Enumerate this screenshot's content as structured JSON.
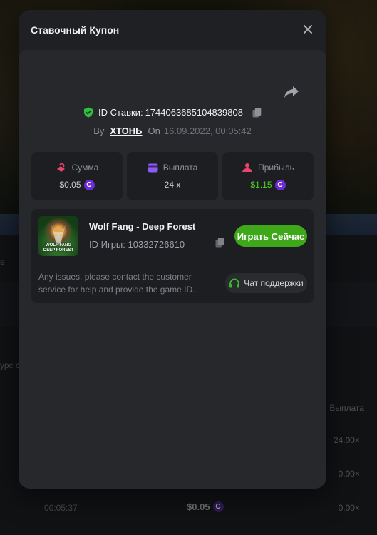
{
  "modal": {
    "title": "Ставочный Купон",
    "bet_id_label": "ID Ставки:",
    "bet_id": "1744063685104839808",
    "by_label": "By",
    "username": "ХТОНЬ",
    "on_label": "On",
    "date": "16.09.2022, 00:05:42"
  },
  "stats": {
    "amount_label": "Сумма",
    "amount_value": "$0.05",
    "payout_label": "Выплата",
    "payout_value": "24 x",
    "profit_label": "Прибыль",
    "profit_value": "$1.15"
  },
  "game": {
    "name": "Wolf Fang - Deep Forest",
    "id_label": "ID Игры:",
    "id": "10332726610",
    "thumb_text_1": "WOLF FANG",
    "thumb_text_2": "DEEP FOREST",
    "play_button": "Играть Сейчас",
    "issues_text": "Any issues, please contact the customer service for help and provide the game ID.",
    "support_button": "Чат поддержки"
  },
  "background": {
    "left_fragment": "s",
    "side_text": "урс с",
    "payout_header": "Выплата",
    "payout_rows": [
      "24.00×",
      "0.00×",
      "0.00×",
      "0.00×"
    ],
    "row_time": "00:05:37",
    "row_amount": "$0.05"
  },
  "colors": {
    "accent_green": "#3fa81a",
    "profit_green": "#4fd41e",
    "coin_purple": "#6c2dd6",
    "verified_green": "#2fc041"
  }
}
